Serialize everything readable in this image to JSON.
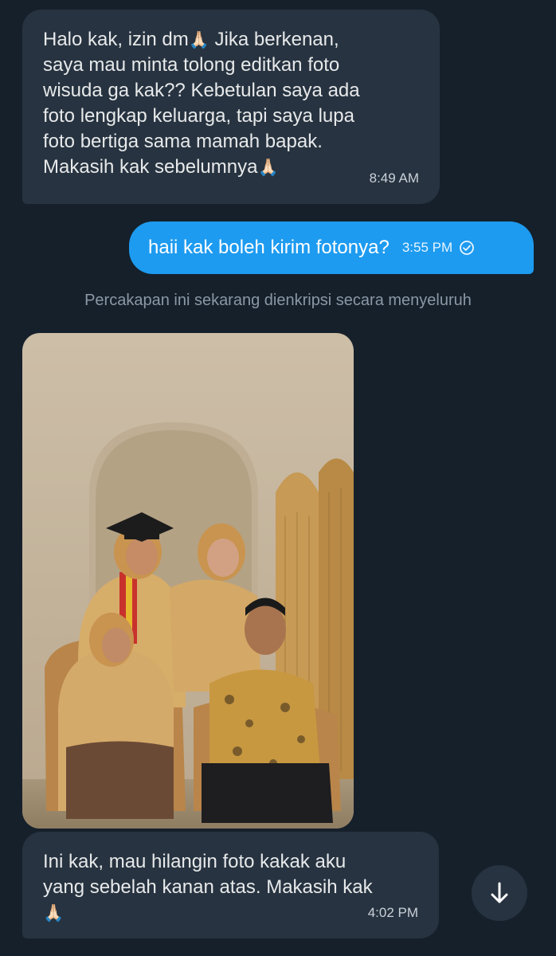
{
  "messages": [
    {
      "text_lines": [
        "Halo kak, izin dm",
        " Jika berkenan,",
        "saya mau  minta tolong editkan foto",
        "wisuda ga kak?? Kebetulan saya ada",
        "foto lengkap keluarga, tapi saya lupa",
        "foto bertiga sama mamah bapak.",
        "Makasih kak sebelumnya"
      ],
      "emoji": "🙏🏻",
      "time": "8:49 AM"
    },
    {
      "text": "haii kak boleh kirim fotonya?",
      "time": "3:55 PM",
      "status_icon": "sent-check-circle-icon"
    },
    {
      "text_lines": [
        "Ini kak, mau hilangin foto kakak aku",
        "yang sebelah kanan atas. Makasih kak"
      ],
      "emoji": "🙏🏻",
      "time": "4:02 PM"
    }
  ],
  "notice": "Percakapan ini sekarang dienkripsi secara menyeluruh",
  "colors": {
    "background": "#15202b",
    "incoming_bubble": "#273340",
    "outgoing_bubble": "#1d9bf0",
    "notice_text": "#8b98a5"
  },
  "scroll_button_icon": "arrow-down-icon"
}
